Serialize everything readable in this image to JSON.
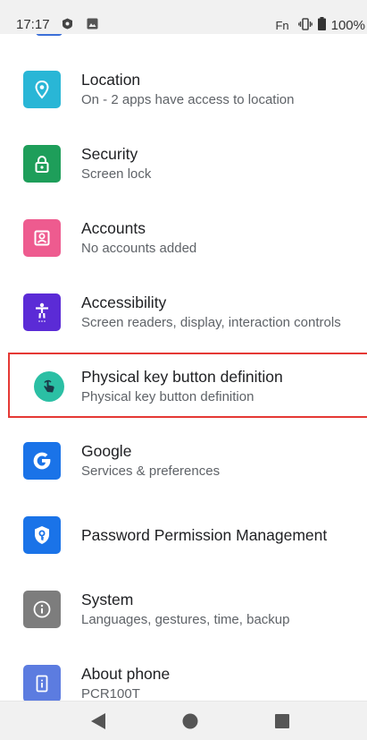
{
  "status_bar": {
    "time": "17:17",
    "fn_label": "Fn",
    "battery": "100%"
  },
  "settings": {
    "items": [
      {
        "title": "Location",
        "subtitle": "On - 2 apps have access to location",
        "icon": "location-icon",
        "color": "#29b6d6"
      },
      {
        "title": "Security",
        "subtitle": "Screen lock",
        "icon": "lock-icon",
        "color": "#1e9e5a"
      },
      {
        "title": "Accounts",
        "subtitle": "No accounts added",
        "icon": "account-icon",
        "color": "#ee5b8f"
      },
      {
        "title": "Accessibility",
        "subtitle": "Screen readers, display, interaction controls",
        "icon": "accessibility-icon",
        "color": "#5b2bd6"
      },
      {
        "title": "Physical key button definition",
        "subtitle": "Physical key button definition",
        "icon": "hand-tap-icon",
        "color": "#2bbfa4"
      },
      {
        "title": "Google",
        "subtitle": "Services & preferences",
        "icon": "google-icon",
        "color": "#1a73e8"
      },
      {
        "title": "Password Permission Management",
        "subtitle": "",
        "icon": "shield-key-icon",
        "color": "#1a73e8"
      },
      {
        "title": "System",
        "subtitle": "Languages, gestures, time, backup",
        "icon": "info-icon",
        "color": "#7d7d7d"
      },
      {
        "title": "About phone",
        "subtitle": "PCR100T",
        "icon": "phone-icon",
        "color": "#5c7ce0"
      }
    ]
  },
  "nav_bar": {
    "back": "back-icon",
    "home": "home-icon",
    "recents": "recents-icon"
  }
}
